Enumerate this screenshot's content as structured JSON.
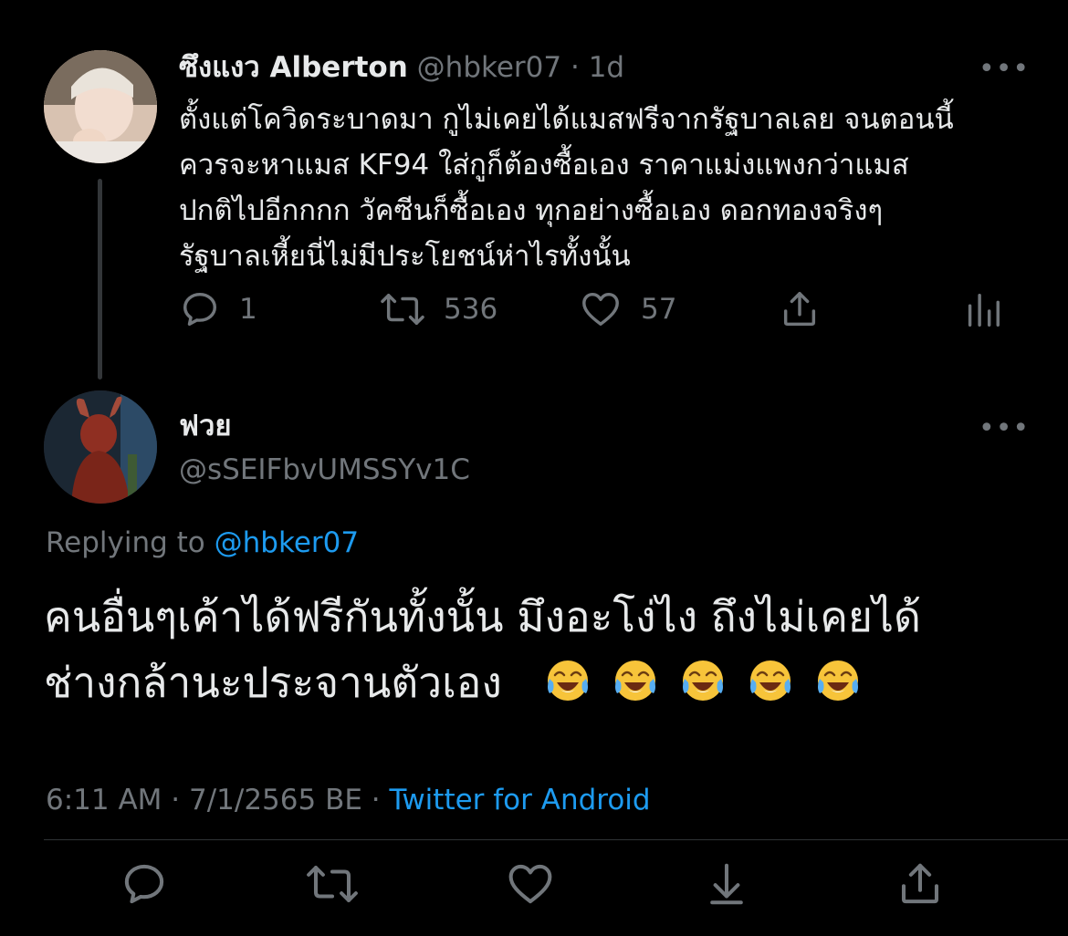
{
  "tweet1": {
    "display_name": "ซึงแงว Alberton",
    "handle": "@hbker07",
    "separator": "·",
    "time_ago": "1d",
    "text": "ตั้งแต่โควิดระบาดมา กูไม่เคยได้แมสฟรีจากรัฐบาลเลย จนตอนนี้\nควรจะหาแมส KF94 ใส่กูก็ต้องซื้อเอง ราคาแม่งแพงกว่าแมส\nปกติไปอีกกกก วัคซีนก็ซื้อเอง ทุกอย่างซื้อเอง ดอกทองจริงๆ\nรัฐบาลเหี้ยนี่ไม่มีประโยชน์ห่าไรทั้งนั้น",
    "replies": "1",
    "retweets": "536",
    "likes": "57",
    "more": "•••"
  },
  "tweet2": {
    "display_name": "ฟวย",
    "handle": "@sSEIFbvUMSSYv1C",
    "replying_label": "Replying to",
    "replying_to": "@hbker07",
    "text": "คนอื่นๆเค้าได้ฟรีกันทั้งนั้น มึงอะโง่ไง ถึงไม่เคยได้\nช่างกล้านะประจานตัวเอง",
    "emoji_count": 5,
    "time": "6:11 AM",
    "date": "7/1/2565 BE",
    "separator": "·",
    "source": "Twitter for Android",
    "more": "•••"
  },
  "icons": {
    "reply": "reply-icon",
    "retweet": "retweet-icon",
    "like": "heart-icon",
    "share": "share-icon",
    "analytics": "analytics-icon",
    "save": "download-icon"
  },
  "colors": {
    "background": "#000000",
    "text": "#e7e9ea",
    "muted": "#71767b",
    "link": "#1d9bf0"
  }
}
